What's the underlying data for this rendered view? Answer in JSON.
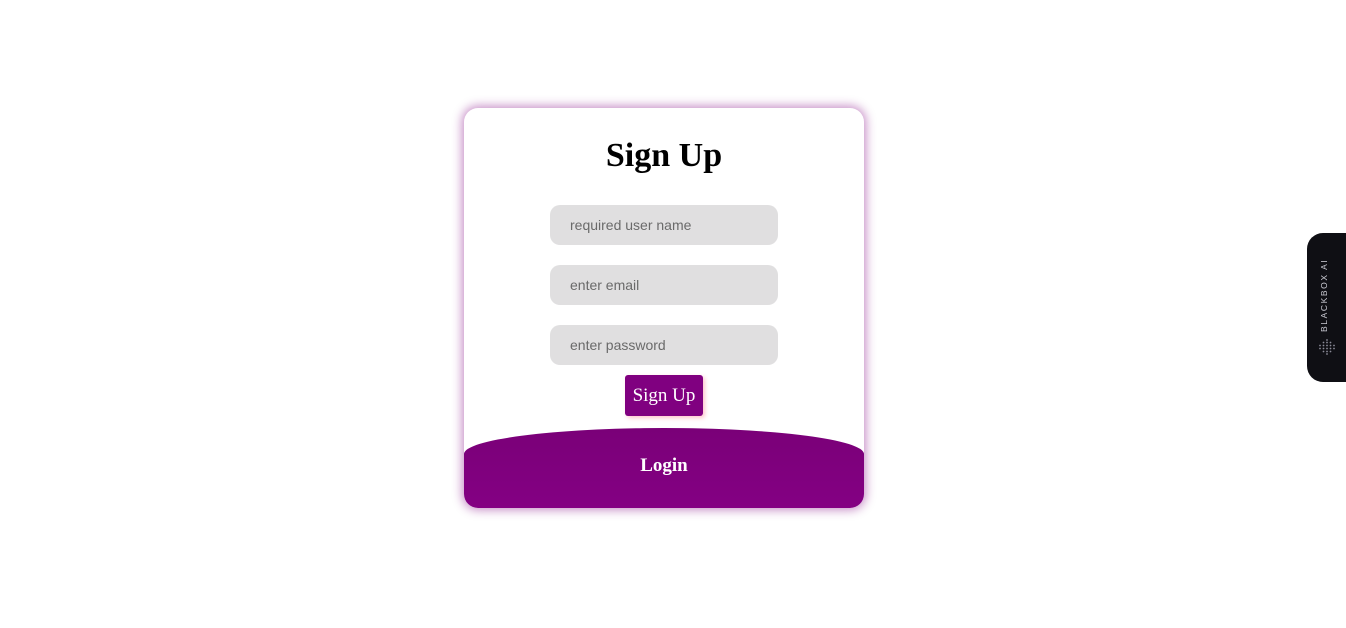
{
  "form": {
    "title": "Sign Up",
    "fields": [
      {
        "name": "username",
        "placeholder": "required user name",
        "value": ""
      },
      {
        "name": "email",
        "placeholder": "enter email",
        "value": ""
      },
      {
        "name": "password",
        "placeholder": "enter password",
        "value": ""
      }
    ],
    "submit_label": "Sign Up",
    "login_label": "Login"
  },
  "side_tab": {
    "label": "BLACKBOX AI",
    "icon": "blackbox-logo-icon"
  },
  "colors": {
    "accent": "#800080",
    "field_bg": "#e0dfe0",
    "side_tab_bg": "#0f0f14"
  }
}
